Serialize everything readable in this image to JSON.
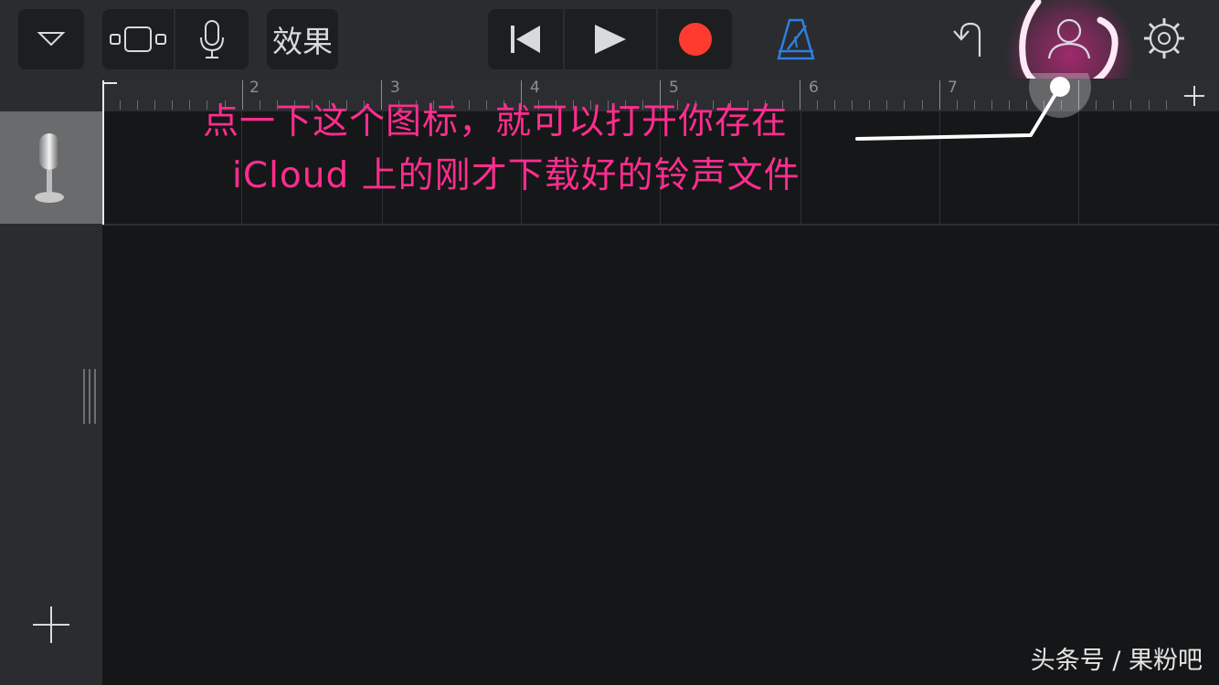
{
  "toolbar": {
    "view_menu_icon": "triangle-down-icon",
    "tracks_view_icon": "tracks-view-icon",
    "mic_icon": "microphone-icon",
    "fx_label": "效果",
    "rewind_icon": "skip-back-icon",
    "play_icon": "play-icon",
    "record_icon": "record-icon",
    "metronome_icon": "metronome-icon",
    "undo_icon": "undo-icon",
    "loops_icon": "loops-icon",
    "settings_icon": "gear-icon"
  },
  "ruler": {
    "bar_numbers": [
      "2",
      "3",
      "4",
      "5",
      "6",
      "7"
    ],
    "add_section_icon": "plus-icon"
  },
  "track": {
    "instrument_icon": "microphone-track-icon"
  },
  "sidebar": {
    "add_track_icon": "plus-icon"
  },
  "annotation": {
    "line1": "点一下这个图标，就可以打开你存在",
    "line2": "iCloud 上的刚才下载好的铃声文件"
  },
  "watermark": "头条号 / 果粉吧",
  "colors": {
    "record": "#ff3b30",
    "metronome": "#2f7fe0",
    "annotation": "#ff2d8f"
  }
}
